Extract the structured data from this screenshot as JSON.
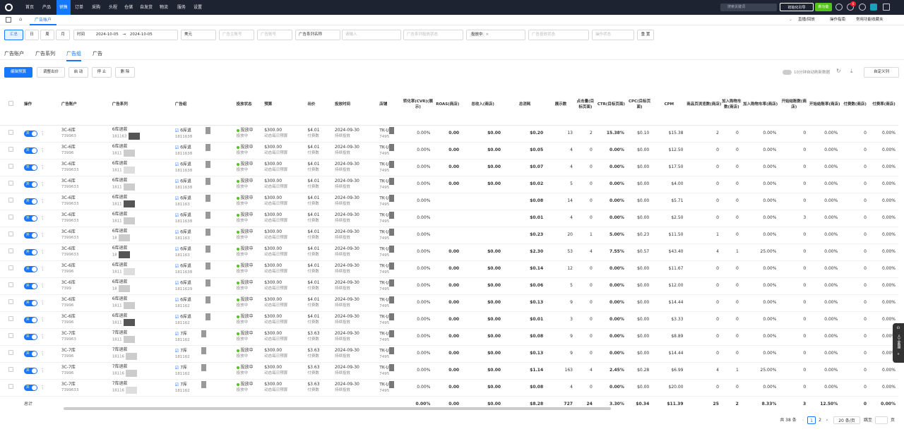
{
  "topnav": {
    "items": [
      "首页",
      "产品",
      "销售",
      "订单",
      "采购",
      "头程",
      "仓储",
      "自发货",
      "物流",
      "服务",
      "设置"
    ],
    "active_index": 2,
    "search_placeholder": "搜索关键词",
    "init_btn": "初始化引导",
    "new_btn": "新功能",
    "bell_count": "6"
  },
  "subnav": {
    "active_tab": "广告账户",
    "right": [
      "直播/回放",
      "操作指南",
      "常用功能收藏夹"
    ]
  },
  "filters": {
    "summary": "汇总",
    "day": "日",
    "week": "周",
    "month": "月",
    "time_label": "时间",
    "date_start": "2024-10-05",
    "date_end": "2024-10-05",
    "currency": "美元",
    "account_ph": "广告主账号",
    "account2_ph": "广告账号",
    "series_label": "广告系列名称",
    "input_ph": "请输入",
    "series_type_ph": "广告系列投放状态",
    "status_selected": "投放中",
    "group_status_ph": "广告投放状态",
    "op_status_ph": "操作状态",
    "reset": "重 置"
  },
  "account_tabs": [
    "广告账户",
    "广告系列",
    "广告组",
    "广告"
  ],
  "account_tab_active": 2,
  "actions": {
    "buttons": [
      "编辑预算",
      "调整出价",
      "启 动",
      "停 止",
      "删 除"
    ],
    "refresh_text": "10分钟自动刷新数据",
    "custom_cols": "自定义列"
  },
  "table": {
    "headers": [
      "操作",
      "广告账户",
      "广告系列",
      "广告组",
      "投放状态",
      "预算",
      "出价",
      "投放时间",
      "店铺",
      "转化率(CVR)(展示)",
      "ROAS(商店)",
      "总收入(商店)",
      "总消耗",
      "展示数",
      "点击量(目标页面)",
      "CTR(目标页面)",
      "CPC(目标页面)",
      "CPM",
      "商品页浏览数(商店)",
      "加入购物车数(商店)",
      "加入购物车率(商店)",
      "开始结账数(商店)",
      "开始结账率(商店)",
      "付费数(商店)",
      "付费率(商店)"
    ],
    "toggle_text": "开",
    "status_text": "投放中",
    "status_sub": "投放中",
    "budget_sub": "动态每日预算",
    "bid_sub": "付费数",
    "time_sub": "持续投放",
    "rows": [
      {
        "acct": "3C-6库",
        "acct_id": "739963",
        "series": "6库退款",
        "series_id": "181163",
        "group": "6库退",
        "group_id": "1811638",
        "budget": "$300.00",
        "bid": "$4.01",
        "start": "2024-09-30",
        "store": "TK-U",
        "store_id": "7495",
        "cvr": "0.00%",
        "roas": "0.00",
        "rev": "$0.00",
        "spend": "$0.20",
        "imp": "13",
        "clk": "2",
        "ctr": "15.38%",
        "cpc": "$0.10",
        "cpm": "$15.38",
        "pv": "2",
        "atc": "0",
        "atcr": "0.00%",
        "ck": "0",
        "ckr": "0.00%",
        "pay": "0",
        "payr": "0.00%"
      },
      {
        "acct": "3C-6库",
        "acct_id": "73996",
        "series": "6库退款",
        "series_id": "1811",
        "group": "6库退",
        "group_id": "1811638",
        "budget": "$300.00",
        "bid": "$4.01",
        "start": "2024-09-30",
        "store": "TK-U",
        "store_id": "7495",
        "cvr": "0.00%",
        "roas": "0.00",
        "rev": "$0.00",
        "spend": "$0.05",
        "imp": "4",
        "clk": "0",
        "ctr": "0.00%",
        "cpc": "$0.00",
        "cpm": "$12.50",
        "pv": "0",
        "atc": "0",
        "atcr": "0.00%",
        "ck": "0",
        "ckr": "0.00%",
        "pay": "0",
        "payr": "0.00%"
      },
      {
        "acct": "3C-6库",
        "acct_id": "7399633",
        "series": "6库退款",
        "series_id": "1811",
        "group": "6库退",
        "group_id": "1811638",
        "budget": "$300.00",
        "bid": "$4.01",
        "start": "2024-09-30",
        "store": "TK-U",
        "store_id": "7495",
        "cvr": "0.00%",
        "roas": "0.00",
        "rev": "$0.00",
        "spend": "$0.07",
        "imp": "4",
        "clk": "0",
        "ctr": "0.00%",
        "cpc": "$0.00",
        "cpm": "$17.50",
        "pv": "0",
        "atc": "0",
        "atcr": "0.00%",
        "ck": "0",
        "ckr": "0.00%",
        "pay": "0",
        "payr": "0.00%"
      },
      {
        "acct": "3C-6库",
        "acct_id": "7399633",
        "series": "6库退款",
        "series_id": "1811",
        "group": "6库退",
        "group_id": "1811638",
        "budget": "$300.00",
        "bid": "$4.01",
        "start": "2024-09-30",
        "store": "TK-U",
        "store_id": "7495",
        "cvr": "0.00%",
        "roas": "0.00",
        "rev": "$0.00",
        "spend": "$0.02",
        "imp": "5",
        "clk": "0",
        "ctr": "0.00%",
        "cpc": "$0.00",
        "cpm": "$4.00",
        "pv": "0",
        "atc": "0",
        "atcr": "0.00%",
        "ck": "0",
        "ckr": "0.00%",
        "pay": "0",
        "payr": "0.00%"
      },
      {
        "acct": "3C-6库",
        "acct_id": "7399633",
        "series": "6库退款",
        "series_id": "1811",
        "group": "6库退",
        "group_id": "181163",
        "budget": "$300.00",
        "bid": "$4.01",
        "start": "2024-09-30",
        "store": "TK-U",
        "store_id": "7495",
        "cvr": "0.00%",
        "roas": "",
        "rev": "",
        "spend": "$0.08",
        "imp": "14",
        "clk": "0",
        "ctr": "0.00%",
        "cpc": "$0.00",
        "cpm": "$5.71",
        "pv": "0",
        "atc": "0",
        "atcr": "0.00%",
        "ck": "0",
        "ckr": "0.00%",
        "pay": "0",
        "payr": "0.00%"
      },
      {
        "acct": "3C-6库",
        "acct_id": "7399633",
        "series": "6库退款",
        "series_id": "1811",
        "group": "6库退",
        "group_id": "1811638",
        "budget": "$300.00",
        "bid": "$4.01",
        "start": "2024-09-30",
        "store": "TK-U",
        "store_id": "7495",
        "cvr": "0.00%",
        "roas": "",
        "rev": "",
        "spend": "$0.01",
        "imp": "4",
        "clk": "0",
        "ctr": "0.00%",
        "cpc": "$0.00",
        "cpm": "$2.50",
        "pv": "0",
        "atc": "0",
        "atcr": "0.00%",
        "ck": "3",
        "ckr": "0.00%",
        "pay": "0",
        "payr": "0.00%"
      },
      {
        "acct": "3C-6库",
        "acct_id": "7399633",
        "series": "6库退款",
        "series_id": "18",
        "group": "6库退",
        "group_id": "181163",
        "budget": "$300.00",
        "bid": "$4.01",
        "start": "2024-09-30",
        "store": "TK-U",
        "store_id": "7495",
        "cvr": "0.00%",
        "roas": "",
        "rev": "",
        "spend": "$0.23",
        "imp": "20",
        "clk": "1",
        "ctr": "5.00%",
        "cpc": "$0.23",
        "cpm": "$11.50",
        "pv": "1",
        "atc": "0",
        "atcr": "0.00%",
        "ck": "0",
        "ckr": "0.00%",
        "pay": "0",
        "payr": "0.00%"
      },
      {
        "acct": "3C-6库",
        "acct_id": "7399633",
        "series": "6库退款",
        "series_id": "18",
        "group": "6库退",
        "group_id": "181163",
        "budget": "$300.00",
        "bid": "$4.01",
        "start": "2024-09-30",
        "store": "TK-U",
        "store_id": "7495",
        "cvr": "0.00%",
        "roas": "0.00",
        "rev": "$0.00",
        "spend": "$2.30",
        "imp": "53",
        "clk": "4",
        "ctr": "7.55%",
        "cpc": "$0.57",
        "cpm": "$43.40",
        "pv": "4",
        "atc": "1",
        "atcr": "25.00%",
        "ck": "0",
        "ckr": "0.00%",
        "pay": "0",
        "payr": "0.00%"
      },
      {
        "acct": "3C-6库",
        "acct_id": "73996",
        "series": "6库退款",
        "series_id": "1811",
        "group": "6库退",
        "group_id": "1811638",
        "budget": "$300.00",
        "bid": "$4.01",
        "start": "2024-09-30",
        "store": "TK-U",
        "store_id": "7495",
        "cvr": "0.00%",
        "roas": "0.00",
        "rev": "$0.00",
        "spend": "$0.14",
        "imp": "12",
        "clk": "0",
        "ctr": "0.00%",
        "cpc": "$0.00",
        "cpm": "$11.67",
        "pv": "0",
        "atc": "0",
        "atcr": "0.00%",
        "ck": "0",
        "ckr": "0.00%",
        "pay": "0",
        "payr": "0.00%"
      },
      {
        "acct": "3C-6库",
        "acct_id": "7399",
        "series": "6库退款",
        "series_id": "18",
        "group": "6库退",
        "group_id": "1811629",
        "budget": "$300.00",
        "bid": "$4.01",
        "start": "2024-09-30",
        "store": "TK-U",
        "store_id": "7495",
        "cvr": "0.00%",
        "roas": "0.00",
        "rev": "$0.00",
        "spend": "$0.06",
        "imp": "5",
        "clk": "0",
        "ctr": "0.00%",
        "cpc": "$0.00",
        "cpm": "$12.00",
        "pv": "0",
        "atc": "0",
        "atcr": "0.00%",
        "ck": "0",
        "ckr": "0.00%",
        "pay": "0",
        "payr": "0.00%"
      },
      {
        "acct": "3C-6库",
        "acct_id": "73996",
        "series": "6库退款",
        "series_id": "1811",
        "group": "6库退",
        "group_id": "181162",
        "budget": "$300.00",
        "bid": "$4.01",
        "start": "2024-09-30",
        "store": "TK-U",
        "store_id": "7495",
        "cvr": "0.00%",
        "roas": "0.00",
        "rev": "$0.00",
        "spend": "$0.13",
        "imp": "9",
        "clk": "0",
        "ctr": "0.00%",
        "cpc": "$0.00",
        "cpm": "$14.44",
        "pv": "0",
        "atc": "0",
        "atcr": "0.00%",
        "ck": "0",
        "ckr": "0.00%",
        "pay": "0",
        "payr": "0.00%"
      },
      {
        "acct": "3C-6库",
        "acct_id": "73996",
        "series": "6库退款",
        "series_id": "1811",
        "group": "6库退",
        "group_id": "181162",
        "budget": "$300.00",
        "bid": "$4.01",
        "start": "2024-09-30",
        "store": "TK-U",
        "store_id": "7495",
        "cvr": "0.00%",
        "roas": "0.00",
        "rev": "$0.00",
        "spend": "$0.01",
        "imp": "3",
        "clk": "0",
        "ctr": "0.00%",
        "cpc": "$0.00",
        "cpm": "$3.33",
        "pv": "0",
        "atc": "0",
        "atcr": "0.00%",
        "ck": "0",
        "ckr": "0.00%",
        "pay": "0",
        "payr": "0.00%"
      },
      {
        "acct": "3C-7库",
        "acct_id": "739963",
        "series": "7库退款",
        "series_id": "1811",
        "group": "7库",
        "group_id": "181162",
        "budget": "$300.00",
        "bid": "$3.63",
        "start": "2024-09-30",
        "store": "TK-U",
        "store_id": "7495",
        "cvr": "0.00%",
        "roas": "0.00",
        "rev": "$0.00",
        "spend": "$0.08",
        "imp": "9",
        "clk": "0",
        "ctr": "0.00%",
        "cpc": "$0.00",
        "cpm": "$8.89",
        "pv": "0",
        "atc": "0",
        "atcr": "0.00%",
        "ck": "0",
        "ckr": "0.00%",
        "pay": "0",
        "payr": "0.00%"
      },
      {
        "acct": "3C-7库",
        "acct_id": "73996",
        "series": "7库退款",
        "series_id": "18116",
        "group": "7库",
        "group_id": "181162",
        "budget": "$300.00",
        "bid": "$3.63",
        "start": "2024-09-30",
        "store": "TK-U",
        "store_id": "7495",
        "cvr": "0.00%",
        "roas": "0.00",
        "rev": "$0.00",
        "spend": "$0.13",
        "imp": "9",
        "clk": "0",
        "ctr": "0.00%",
        "cpc": "$0.00",
        "cpm": "$14.44",
        "pv": "0",
        "atc": "0",
        "atcr": "0.00%",
        "ck": "0",
        "ckr": "0.00%",
        "pay": "0",
        "payr": "0.00%"
      },
      {
        "acct": "3C-7库",
        "acct_id": "73996",
        "series": "7库退款",
        "series_id": "18116",
        "group": "7库",
        "group_id": "181162",
        "budget": "$300.00",
        "bid": "$3.63",
        "start": "2024-09-30",
        "store": "TK-U",
        "store_id": "7495",
        "cvr": "0.00%",
        "roas": "0.00",
        "rev": "$0.00",
        "spend": "$1.14",
        "imp": "163",
        "clk": "4",
        "ctr": "2.45%",
        "cpc": "$0.28",
        "cpm": "$6.99",
        "pv": "4",
        "atc": "1",
        "atcr": "25.00%",
        "ck": "0",
        "ckr": "0.00%",
        "pay": "0",
        "payr": "0.00%"
      },
      {
        "acct": "3C-7库",
        "acct_id": "7399633",
        "series": "7库退款",
        "series_id": "18116",
        "group": "7库",
        "group_id": "181162",
        "budget": "$300.00",
        "bid": "$3.63",
        "start": "2024-09-30",
        "store": "TK-U",
        "store_id": "7495",
        "cvr": "0.00%",
        "roas": "0.00",
        "rev": "$0.00",
        "spend": "$0.08",
        "imp": "4",
        "clk": "0",
        "ctr": "0.00%",
        "cpc": "$0.00",
        "cpm": "$20.00",
        "pv": "0",
        "atc": "0",
        "atcr": "0.00%",
        "ck": "0",
        "ckr": "0.00%",
        "pay": "0",
        "payr": "0.00%"
      }
    ],
    "total": {
      "label": "总计",
      "cvr": "0.00%",
      "roas": "0.00",
      "rev": "$0.00",
      "spend": "$8.28",
      "imp": "727",
      "clk": "24",
      "ctr": "3.30%",
      "cpc": "$0.34",
      "cpm": "$11.39",
      "pv": "25",
      "atc": "2",
      "atcr": "8.33%",
      "ck": "3",
      "ckr": "12.50%",
      "pay": "0",
      "payr": "0.00%"
    }
  },
  "pager": {
    "total": "共 38 条",
    "page1": "1",
    "page2": "2",
    "size": "20 条/页",
    "goto": "跳至",
    "page_unit": "页"
  },
  "side_tool": "人工客服"
}
